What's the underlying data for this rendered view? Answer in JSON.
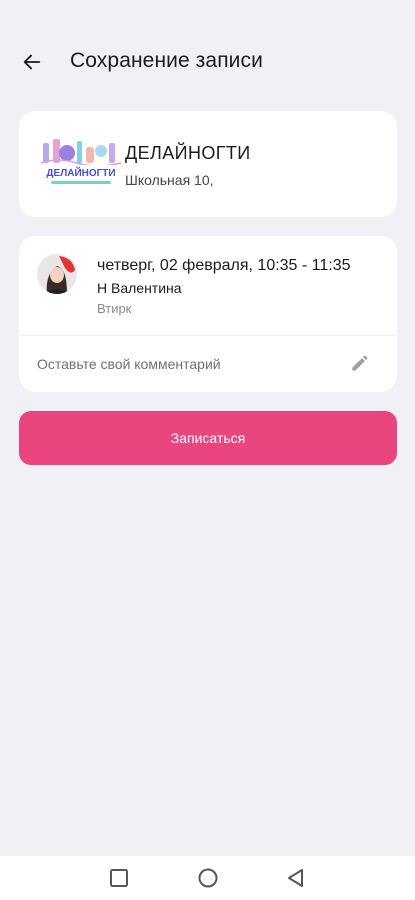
{
  "status_bar": {
    "time": "",
    "indicators": ""
  },
  "header": {
    "title": "Сохранение записи",
    "back_icon": "arrow-left-icon"
  },
  "salon": {
    "name": "ДЕЛАЙНОГТИ",
    "address": "Школьная 10,",
    "logo_text": "ДЕЛАЙНОГТИ"
  },
  "booking": {
    "datetime": "четверг, 02 февраля, 10:35 - 11:35",
    "master": "Н Валентина",
    "service": "Втирк"
  },
  "comment": {
    "placeholder": "Оставьте свой комментарий",
    "icon": "pencil-icon"
  },
  "submit": {
    "label": "Записаться"
  },
  "colors": {
    "background": "#f1f0f6",
    "card": "#ffffff",
    "accent": "#e9467f"
  },
  "system_nav": {
    "icons": [
      "square-recent-icon",
      "circle-home-icon",
      "triangle-back-icon"
    ]
  }
}
